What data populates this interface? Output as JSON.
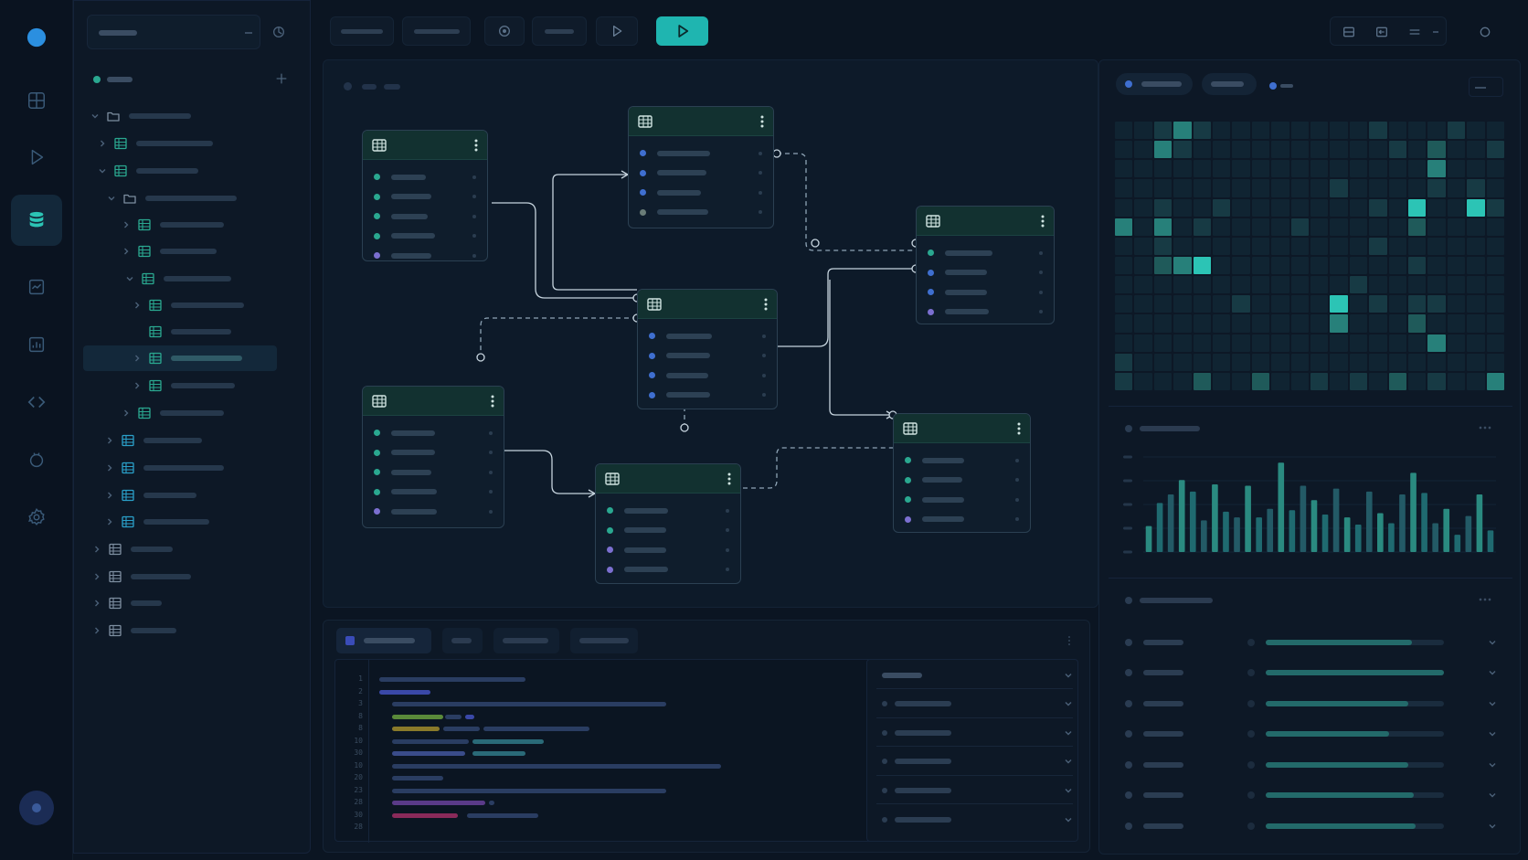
{
  "colors": {
    "accent": "#1fb5b0",
    "background": "#0b1522",
    "table_header": "#123130",
    "heatmap_cell": "#1f6a6a",
    "heatmap_bright": "#2cc4b5"
  },
  "activity_bar": {
    "items": [
      {
        "icon": "brand-icon",
        "active": false
      },
      {
        "icon": "dashboard-icon",
        "active": false
      },
      {
        "icon": "play-icon",
        "active": false
      },
      {
        "icon": "database-icon",
        "active": true
      },
      {
        "icon": "monitor-chart-icon",
        "active": false
      },
      {
        "icon": "analytics-icon",
        "active": false
      },
      {
        "icon": "code-icon",
        "active": false
      },
      {
        "icon": "plugin-icon",
        "active": false
      },
      {
        "icon": "settings-icon",
        "active": false
      }
    ],
    "avatar_icon": "avatar-icon"
  },
  "explorer": {
    "header_icons": [
      "collapse-icon",
      "refresh-icon"
    ],
    "section_icons": [
      "status-dot",
      "add-icon"
    ],
    "tree_icons": [
      "chevron-icon",
      "folder-icon",
      "table-icon"
    ]
  },
  "toolbar": {
    "icons": [
      "history-icon",
      "play-icon",
      "run-icon"
    ],
    "right_icons": [
      "layout-split-icon",
      "layout-panel-icon",
      "menu-icon",
      "refresh-icon"
    ]
  },
  "canvas": {
    "table_icons": [
      "table-icon",
      "more-vertical-icon"
    ]
  },
  "editor": {
    "line_numbers": [
      "1",
      "2",
      "3",
      "8",
      "8",
      "10",
      "30",
      "10",
      "20",
      "23",
      "28",
      "30",
      "28"
    ],
    "icons": [
      "more-vertical-icon",
      "chevron-down-icon"
    ]
  },
  "right_panel": {
    "heatmap": {
      "rows": 14,
      "cols": 20,
      "cells": [
        [
          0,
          0,
          1,
          3,
          1,
          0,
          0,
          0,
          0,
          0,
          0,
          0,
          0,
          1,
          0,
          0,
          0,
          1,
          0,
          0
        ],
        [
          0,
          0,
          3,
          1,
          0,
          0,
          0,
          0,
          0,
          0,
          0,
          0,
          0,
          0,
          1,
          0,
          2,
          0,
          0,
          1
        ],
        [
          0,
          0,
          0,
          0,
          0,
          0,
          0,
          0,
          0,
          0,
          0,
          0,
          0,
          0,
          0,
          0,
          3,
          0,
          0,
          0
        ],
        [
          0,
          0,
          0,
          0,
          0,
          0,
          0,
          0,
          0,
          0,
          0,
          1,
          0,
          0,
          0,
          0,
          1,
          0,
          1,
          0
        ],
        [
          0,
          0,
          1,
          0,
          0,
          1,
          0,
          0,
          0,
          0,
          0,
          0,
          0,
          1,
          0,
          4,
          0,
          0,
          4,
          1
        ],
        [
          3,
          0,
          3,
          0,
          1,
          0,
          0,
          0,
          0,
          1,
          0,
          0,
          0,
          0,
          0,
          2,
          0,
          0,
          0,
          0
        ],
        [
          0,
          0,
          1,
          0,
          0,
          0,
          0,
          0,
          0,
          0,
          0,
          0,
          0,
          1,
          0,
          0,
          0,
          0,
          0,
          0
        ],
        [
          0,
          0,
          2,
          3,
          4,
          0,
          0,
          0,
          0,
          0,
          0,
          0,
          0,
          0,
          0,
          1,
          0,
          0,
          0,
          0
        ],
        [
          0,
          0,
          0,
          0,
          0,
          0,
          0,
          0,
          0,
          0,
          0,
          0,
          1,
          0,
          0,
          0,
          0,
          0,
          0,
          0
        ],
        [
          0,
          0,
          0,
          0,
          0,
          0,
          1,
          0,
          0,
          0,
          0,
          4,
          0,
          1,
          0,
          1,
          1,
          0,
          0,
          0
        ],
        [
          0,
          0,
          0,
          0,
          0,
          0,
          0,
          0,
          0,
          0,
          0,
          3,
          0,
          0,
          0,
          2,
          0,
          0,
          0,
          0
        ],
        [
          0,
          0,
          0,
          0,
          0,
          0,
          0,
          0,
          0,
          0,
          0,
          0,
          0,
          0,
          0,
          0,
          3,
          0,
          0,
          0
        ],
        [
          1,
          0,
          0,
          0,
          0,
          0,
          0,
          0,
          0,
          0,
          0,
          0,
          0,
          0,
          0,
          0,
          0,
          0,
          0,
          0
        ],
        [
          1,
          0,
          0,
          0,
          2,
          0,
          0,
          2,
          0,
          0,
          1,
          0,
          1,
          0,
          2,
          0,
          1,
          0,
          0,
          3
        ]
      ]
    },
    "chart_data": {
      "type": "bar",
      "values": [
        18,
        34,
        40,
        50,
        42,
        22,
        47,
        28,
        24,
        46,
        24,
        30,
        62,
        29,
        46,
        36,
        26,
        44,
        24,
        19,
        42,
        27,
        20,
        40,
        55,
        41,
        20,
        30,
        12,
        25,
        40,
        15
      ],
      "ylim": [
        0,
        66
      ]
    },
    "more_icon": "more-horizontal-icon",
    "list_rows": [
      {
        "fill": 0.82
      },
      {
        "fill": 1.0
      },
      {
        "fill": 0.8
      },
      {
        "fill": 0.69
      },
      {
        "fill": 0.8
      },
      {
        "fill": 0.83
      },
      {
        "fill": 0.84
      }
    ]
  }
}
